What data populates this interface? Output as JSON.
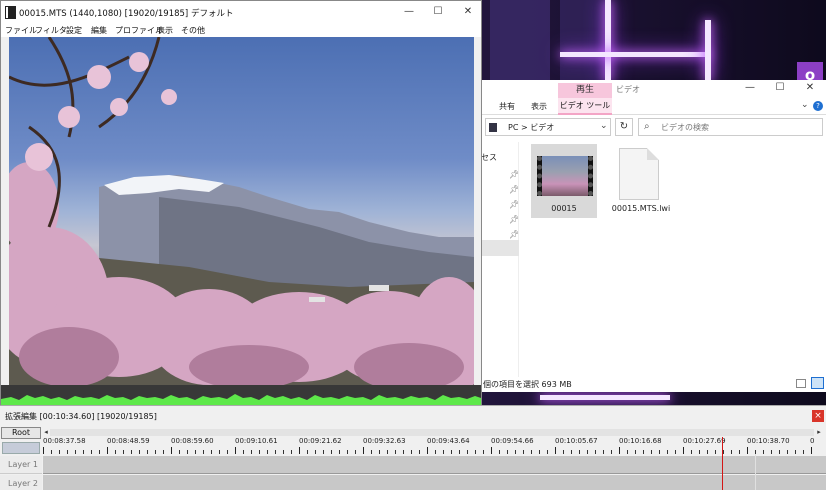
{
  "aviutl": {
    "title": "00015.MTS (1440,1080)  [19020/19185]  デフォルト",
    "menu": [
      "ファイル",
      "フィルタ",
      "設定",
      "編集",
      "プロファイル",
      "表示",
      "その他"
    ],
    "controls": {
      "minimize": "—",
      "maximize": "☐",
      "close": "✕"
    }
  },
  "explorer": {
    "context_tab": "再生",
    "title_label": "ビデオ",
    "ribbon_tabs": [
      "共有",
      "表示"
    ],
    "ribbon_active": "ビデオ ツール",
    "address": "PC  >  ビデオ",
    "search_placeholder": "ビデオの検索",
    "nav_quick_access": "セス",
    "files": [
      {
        "name": "00015"
      },
      {
        "name": "00015.MTS.lwi"
      }
    ],
    "status": "個の項目を選択  693 MB",
    "controls": {
      "minimize": "—",
      "maximize": "☐",
      "close": "✕"
    }
  },
  "desktop": {
    "badge": "o"
  },
  "timeline": {
    "title": "拡張編集 [00:10:34.60] [19020/19185]",
    "root_label": "Root",
    "ticks": [
      "00:08:37.58",
      "00:08:48.59",
      "00:08:59.60",
      "00:09:10.61",
      "00:09:21.62",
      "00:09:32.63",
      "00:09:43.64",
      "00:09:54.66",
      "00:10:05.67",
      "00:10:16.68",
      "00:10:27.69",
      "00:10:38.70",
      "0"
    ],
    "layers": [
      "Layer 1",
      "Layer 2"
    ],
    "close_label": "×"
  },
  "colors": {
    "explorer_accent": "#f7c6dc",
    "waveform": "#5ee84a",
    "cursor": "#d31616",
    "neon": "#d06cff"
  }
}
